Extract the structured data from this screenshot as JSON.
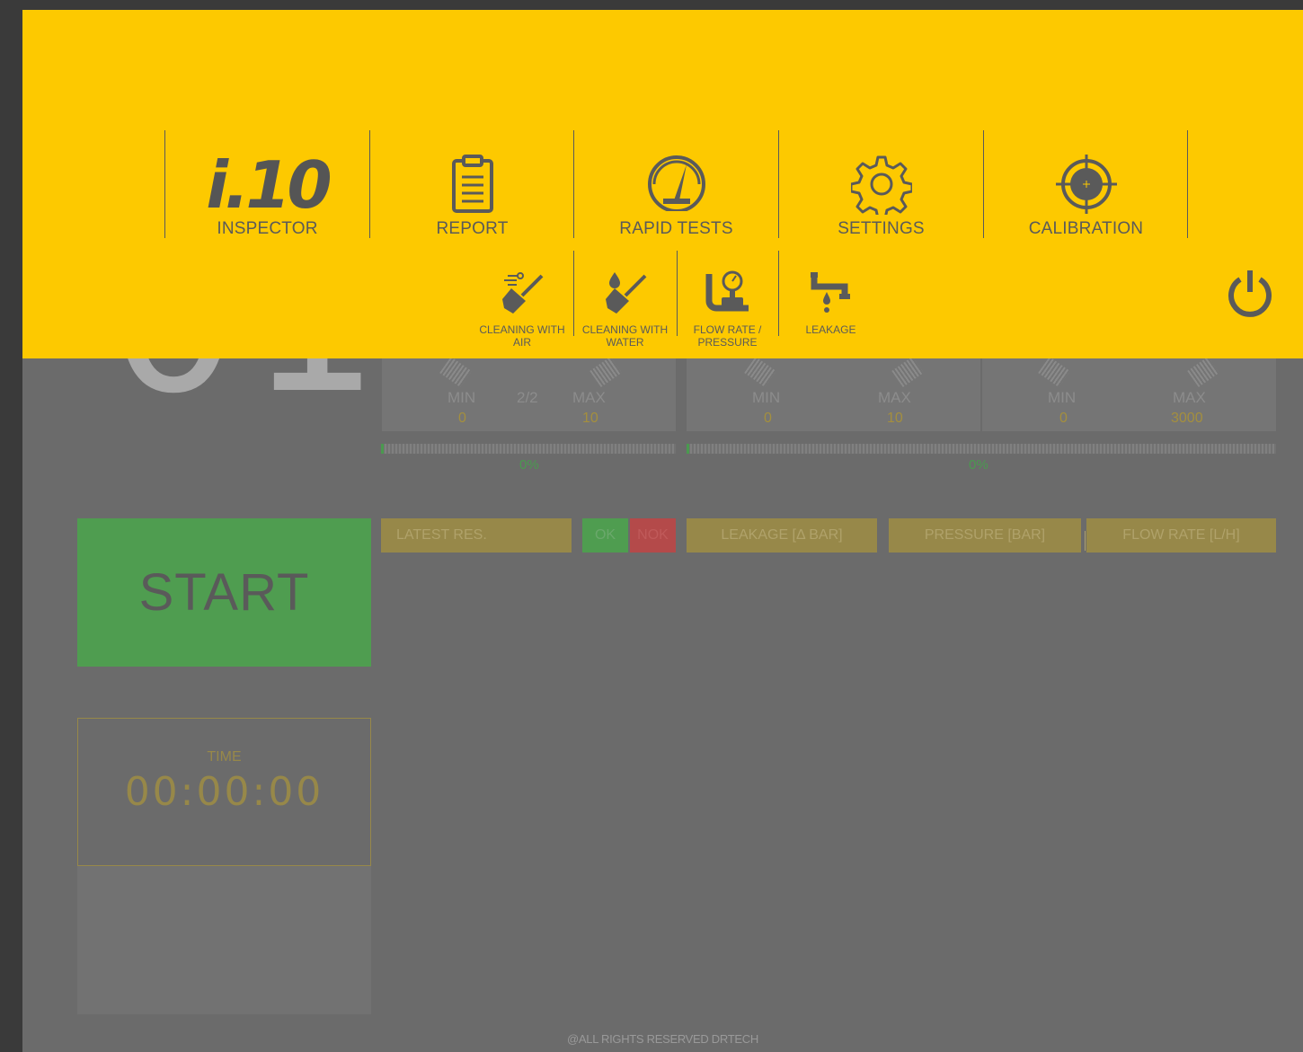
{
  "app": {
    "station_number": "01",
    "footer": "@ALL RIGHTS RESERVED DRTECH"
  },
  "menu": {
    "logo_text": "i.10",
    "main_items": [
      {
        "label": "INSPECTOR",
        "icon": "i10-logo-icon"
      },
      {
        "label": "REPORT",
        "icon": "clipboard-icon"
      },
      {
        "label": "RAPID TESTS",
        "icon": "speedometer-icon"
      },
      {
        "label": "SETTINGS",
        "icon": "gear-icon"
      },
      {
        "label": "CALIBRATION",
        "icon": "crosshair-icon"
      }
    ],
    "sub_items": [
      {
        "label_line1": "CLEANING WITH",
        "label_line2": "AIR",
        "icon": "air-cleaning-broom-icon"
      },
      {
        "label_line1": "CLEANING WITH",
        "label_line2": "WATER",
        "icon": "water-cleaning-broom-icon"
      },
      {
        "label_line1": "FLOW RATE /",
        "label_line2": "PRESSURE",
        "icon": "flow-pressure-icon"
      },
      {
        "label_line1": "",
        "label_line2": "LEAKAGE",
        "icon": "leaking-pipe-icon"
      }
    ],
    "power_icon": "power-icon"
  },
  "gauges": [
    {
      "min_label": "MIN",
      "max_label": "MAX",
      "min": "0",
      "max": "10",
      "step": "2/2"
    },
    {
      "min_label": "MIN",
      "max_label": "MAX",
      "min": "0",
      "max": "10"
    },
    {
      "min_label": "MIN",
      "max_label": "MAX",
      "min": "0",
      "max": "3000"
    }
  ],
  "progress": [
    {
      "percent_text": "0%",
      "value": 0
    },
    {
      "percent_text": "0%",
      "value": 0
    }
  ],
  "controls": {
    "start_label": "START",
    "time_label": "TIME",
    "time_value": "00:00:00"
  },
  "results": {
    "latest_label": "LATEST RES.",
    "ok_label": "OK",
    "nok_label": "NOK",
    "leakage_label": "LEAKAGE [Δ BAR]",
    "pressure_label": "PRESSURE [BAR]",
    "flow_label": "FLOW RATE [L/H]"
  },
  "colors": {
    "menu_bg": "#fdc900",
    "icon_gray": "#5a5a5a",
    "ok_green": "#4f9d50",
    "nok_red": "#b44a4a",
    "result_gold": "#978849"
  }
}
